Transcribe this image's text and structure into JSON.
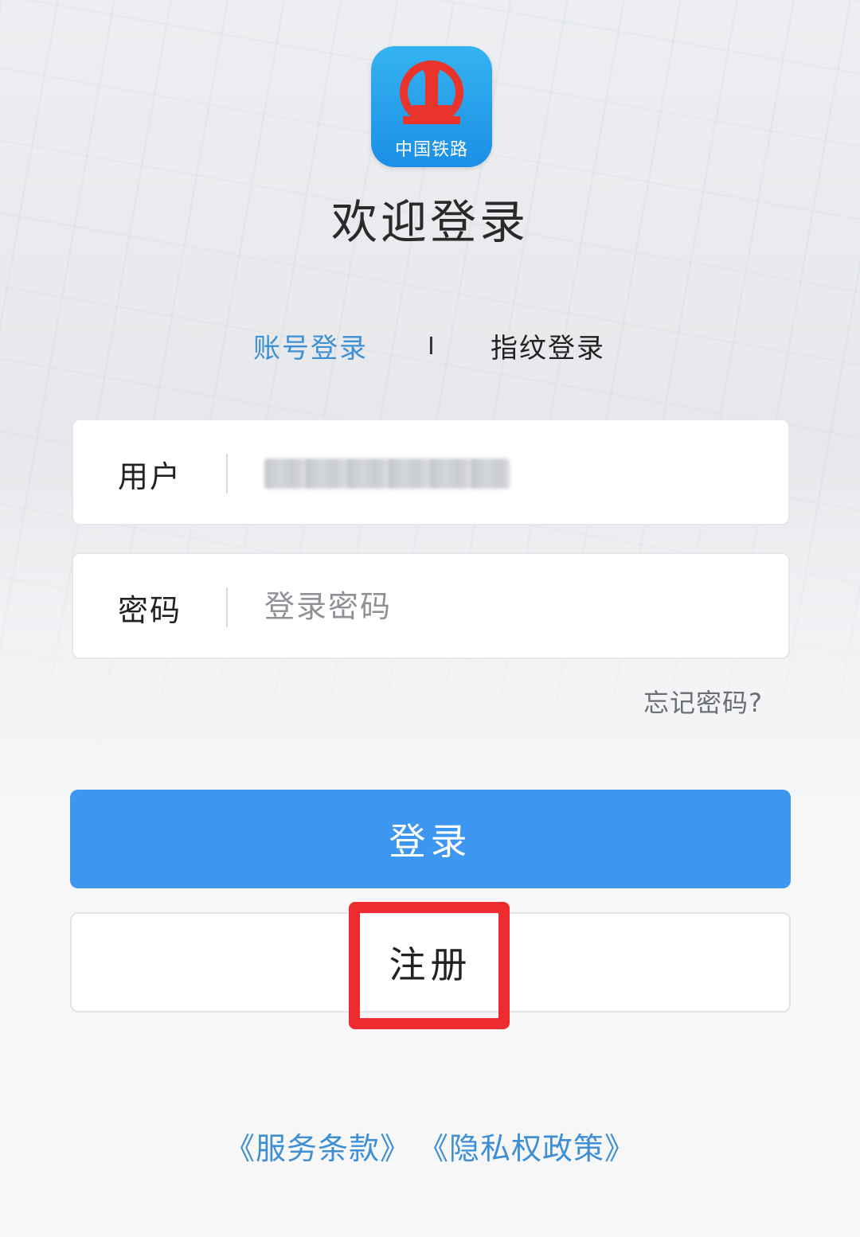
{
  "logo": {
    "text": "中国铁路"
  },
  "title": "欢迎登录",
  "tabs": {
    "account": "账号登录",
    "separator": "I",
    "fingerprint": "指纹登录"
  },
  "form": {
    "user_label": "用户",
    "password_label": "密码",
    "password_placeholder": "登录密码",
    "forgot": "忘记密码?"
  },
  "buttons": {
    "login": "登录",
    "register": "注册"
  },
  "links": {
    "terms": "《服务条款》",
    "privacy": "《隐私权政策》"
  },
  "colors": {
    "accent": "#3d96ef",
    "link": "#3e8fd3",
    "highlight": "#ee2b2e",
    "logo_red": "#e8342a"
  }
}
